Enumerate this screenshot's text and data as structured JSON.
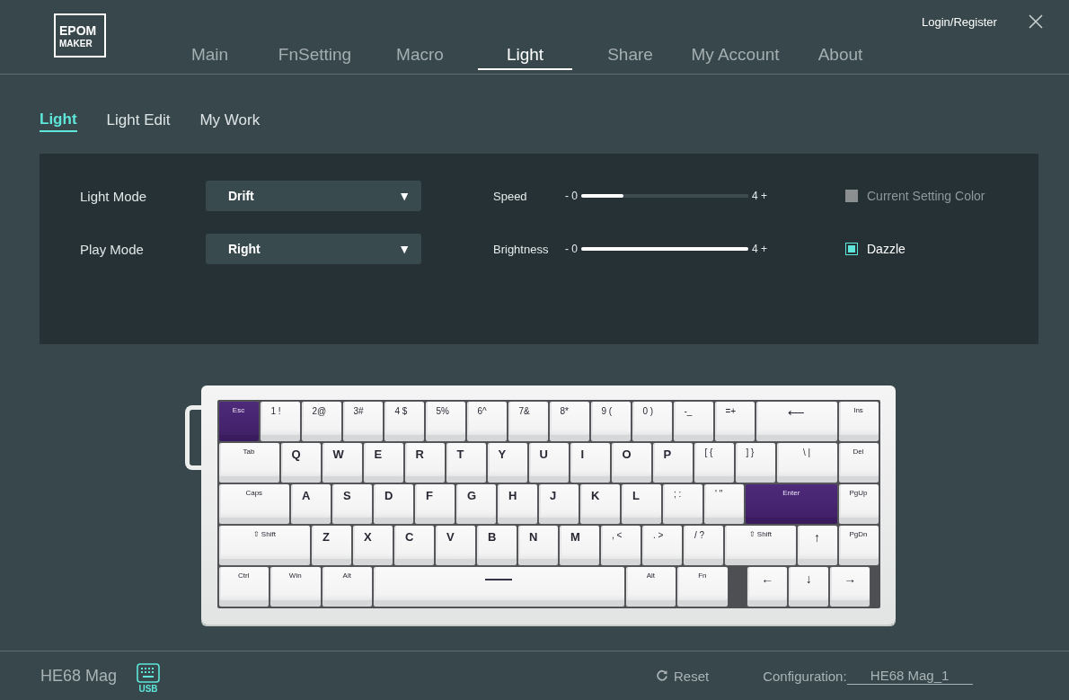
{
  "logo": {
    "top": "EPOM",
    "bottom": "MAKER"
  },
  "nav": [
    {
      "label": "Main",
      "selected": false
    },
    {
      "label": "FnSetting",
      "selected": false
    },
    {
      "label": "Macro",
      "selected": false
    },
    {
      "label": "Light",
      "selected": true
    },
    {
      "label": "Share",
      "selected": false
    },
    {
      "label": "My Account",
      "selected": false
    },
    {
      "label": "About",
      "selected": false
    }
  ],
  "account_link": "Login/Register",
  "sub_tabs": [
    {
      "label": "Light",
      "selected": true
    },
    {
      "label": "Light Edit",
      "selected": false
    },
    {
      "label": "My Work",
      "selected": false
    }
  ],
  "light_panel": {
    "selects": [
      {
        "label": "Light Mode",
        "value": "Drift",
        "caret": "▼"
      },
      {
        "label": "Play Mode",
        "value": "Right",
        "caret": "▼"
      }
    ],
    "sliders": [
      {
        "label": "Speed",
        "min": "- 0",
        "max": "4 +",
        "level": 0.25
      },
      {
        "label": "Brightness",
        "min": "- 0",
        "max": "4 +",
        "level": 1.0
      }
    ],
    "options": [
      {
        "label": "Current Setting Color",
        "checked": false
      },
      {
        "label": "Dazzle",
        "checked": true
      }
    ]
  },
  "keyboard": {
    "rows": [
      {
        "keys": [
          {
            "label": "Esc",
            "kind": "func",
            "lit": true
          },
          {
            "label": "1 !",
            "kind": "num",
            "lit": false
          },
          {
            "label": "2@",
            "kind": "num",
            "lit": false
          },
          {
            "label": "3#",
            "kind": "num",
            "lit": false
          },
          {
            "label": "4 $",
            "kind": "num",
            "lit": false
          },
          {
            "label": "5%",
            "kind": "num",
            "lit": false
          },
          {
            "label": "6^",
            "kind": "num",
            "lit": false
          },
          {
            "label": "7&",
            "kind": "num",
            "lit": false
          },
          {
            "label": "8*",
            "kind": "num",
            "lit": false
          },
          {
            "label": "9 (",
            "kind": "num",
            "lit": false
          },
          {
            "label": "0 )",
            "kind": "num",
            "lit": false
          },
          {
            "label": "-_",
            "kind": "num",
            "lit": false
          },
          {
            "label": "=+",
            "kind": "num",
            "lit": false
          },
          {
            "label": "⟵",
            "kind": "backspace",
            "lit": false
          },
          {
            "label": "Ins",
            "kind": "func",
            "lit": false
          }
        ]
      },
      {
        "keys": [
          {
            "label": "Tab",
            "kind": "tab",
            "lit": false
          },
          {
            "label": "Q",
            "kind": "alpha",
            "lit": false
          },
          {
            "label": "W",
            "kind": "alpha",
            "lit": false
          },
          {
            "label": "E",
            "kind": "alpha",
            "lit": false
          },
          {
            "label": "R",
            "kind": "alpha",
            "lit": false
          },
          {
            "label": "T",
            "kind": "alpha",
            "lit": false
          },
          {
            "label": "Y",
            "kind": "alpha",
            "lit": false
          },
          {
            "label": "U",
            "kind": "alpha",
            "lit": false
          },
          {
            "label": "I",
            "kind": "alpha",
            "lit": false
          },
          {
            "label": "O",
            "kind": "alpha",
            "lit": false
          },
          {
            "label": "P",
            "kind": "alpha",
            "lit": false
          },
          {
            "label": "[ {",
            "kind": "num",
            "lit": false
          },
          {
            "label": "] }",
            "kind": "num",
            "lit": false
          },
          {
            "label": "\\ |",
            "kind": "backslash",
            "lit": false
          },
          {
            "label": "Del",
            "kind": "func",
            "lit": false
          }
        ]
      },
      {
        "keys": [
          {
            "label": "Caps",
            "kind": "caps",
            "lit": false
          },
          {
            "label": "A",
            "kind": "alpha",
            "lit": false
          },
          {
            "label": "S",
            "kind": "alpha",
            "lit": false
          },
          {
            "label": "D",
            "kind": "alpha",
            "lit": false
          },
          {
            "label": "F",
            "kind": "alpha",
            "lit": false
          },
          {
            "label": "G",
            "kind": "alpha",
            "lit": false
          },
          {
            "label": "H",
            "kind": "alpha",
            "lit": false
          },
          {
            "label": "J",
            "kind": "alpha",
            "lit": false
          },
          {
            "label": "K",
            "kind": "alpha",
            "lit": false
          },
          {
            "label": "L",
            "kind": "alpha",
            "lit": false
          },
          {
            "label": "; :",
            "kind": "num",
            "lit": false
          },
          {
            "label": "' \"",
            "kind": "num",
            "lit": false
          },
          {
            "label": "Enter",
            "kind": "enter",
            "lit": true
          },
          {
            "label": "PgUp",
            "kind": "func",
            "lit": false
          }
        ]
      },
      {
        "keys": [
          {
            "label": "⇧ Shift",
            "kind": "lshift",
            "lit": false
          },
          {
            "label": "Z",
            "kind": "alpha",
            "lit": false
          },
          {
            "label": "X",
            "kind": "alpha",
            "lit": false
          },
          {
            "label": "C",
            "kind": "alpha",
            "lit": false
          },
          {
            "label": "V",
            "kind": "alpha",
            "lit": false
          },
          {
            "label": "B",
            "kind": "alpha",
            "lit": false
          },
          {
            "label": "N",
            "kind": "alpha",
            "lit": false
          },
          {
            "label": "M",
            "kind": "alpha",
            "lit": false
          },
          {
            "label": ", <",
            "kind": "num",
            "lit": false
          },
          {
            "label": ". >",
            "kind": "num",
            "lit": false
          },
          {
            "label": "/ ?",
            "kind": "num",
            "lit": false
          },
          {
            "label": "⇧ Shift",
            "kind": "rshift",
            "lit": false
          },
          {
            "label": "↑",
            "kind": "arrow",
            "lit": false
          },
          {
            "label": "PgDn",
            "kind": "func",
            "lit": false
          }
        ]
      },
      {
        "keys": [
          {
            "label": "Ctrl",
            "kind": "mod",
            "lit": false
          },
          {
            "label": "Win",
            "kind": "mod",
            "lit": false
          },
          {
            "label": "Alt",
            "kind": "mod",
            "lit": false
          },
          {
            "kind": "space",
            "lit": false
          },
          {
            "label": "Alt",
            "kind": "mod",
            "lit": false
          },
          {
            "label": "Fn",
            "kind": "mod",
            "lit": false
          },
          {
            "label": "←",
            "kind": "arrow",
            "lit": false
          },
          {
            "label": "↓",
            "kind": "arrow",
            "lit": false
          },
          {
            "label": "→",
            "kind": "arrow",
            "lit": false
          }
        ]
      }
    ]
  },
  "footer": {
    "device": "HE68 Mag",
    "connection": "USB",
    "reset": "Reset",
    "config_label": "Configuration:",
    "config_value": "HE68 Mag_1"
  }
}
